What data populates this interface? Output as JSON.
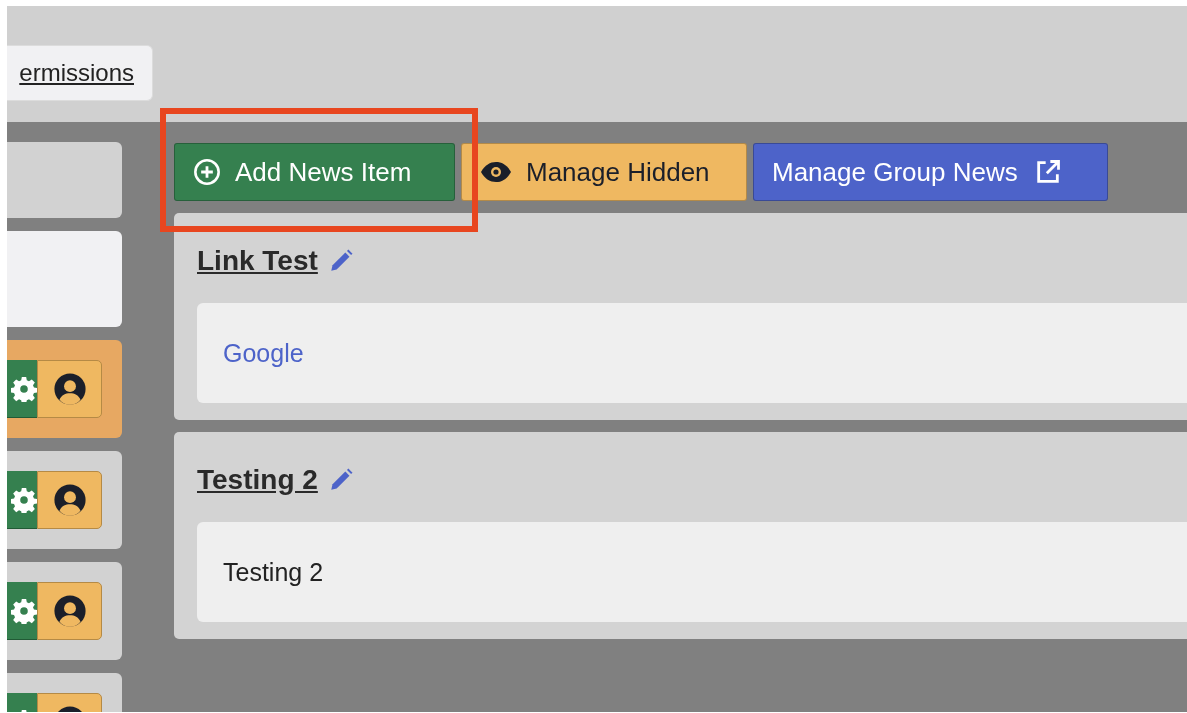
{
  "top_bar": {
    "permissions_button": "ermissions"
  },
  "sidebar_cards": [
    {
      "kind": "blank",
      "selected": false
    },
    {
      "kind": "light",
      "selected": false
    },
    {
      "kind": "controls",
      "selected": true
    },
    {
      "kind": "controls",
      "selected": false
    },
    {
      "kind": "controls",
      "selected": false
    },
    {
      "kind": "controls",
      "selected": false
    }
  ],
  "toolbar": [
    {
      "kind": "add",
      "label": "Add News Item"
    },
    {
      "kind": "hidden",
      "label": "Manage Hidden"
    },
    {
      "kind": "group",
      "label": "Manage Group News"
    }
  ],
  "annotations": [
    {
      "kind": "rectangle",
      "color": "#e8461f"
    }
  ],
  "news_items": [
    {
      "title": "Link Test",
      "body": "Google",
      "kind": "link"
    },
    {
      "title": "Testing 2",
      "body": "Testing 2",
      "kind": "text"
    }
  ]
}
